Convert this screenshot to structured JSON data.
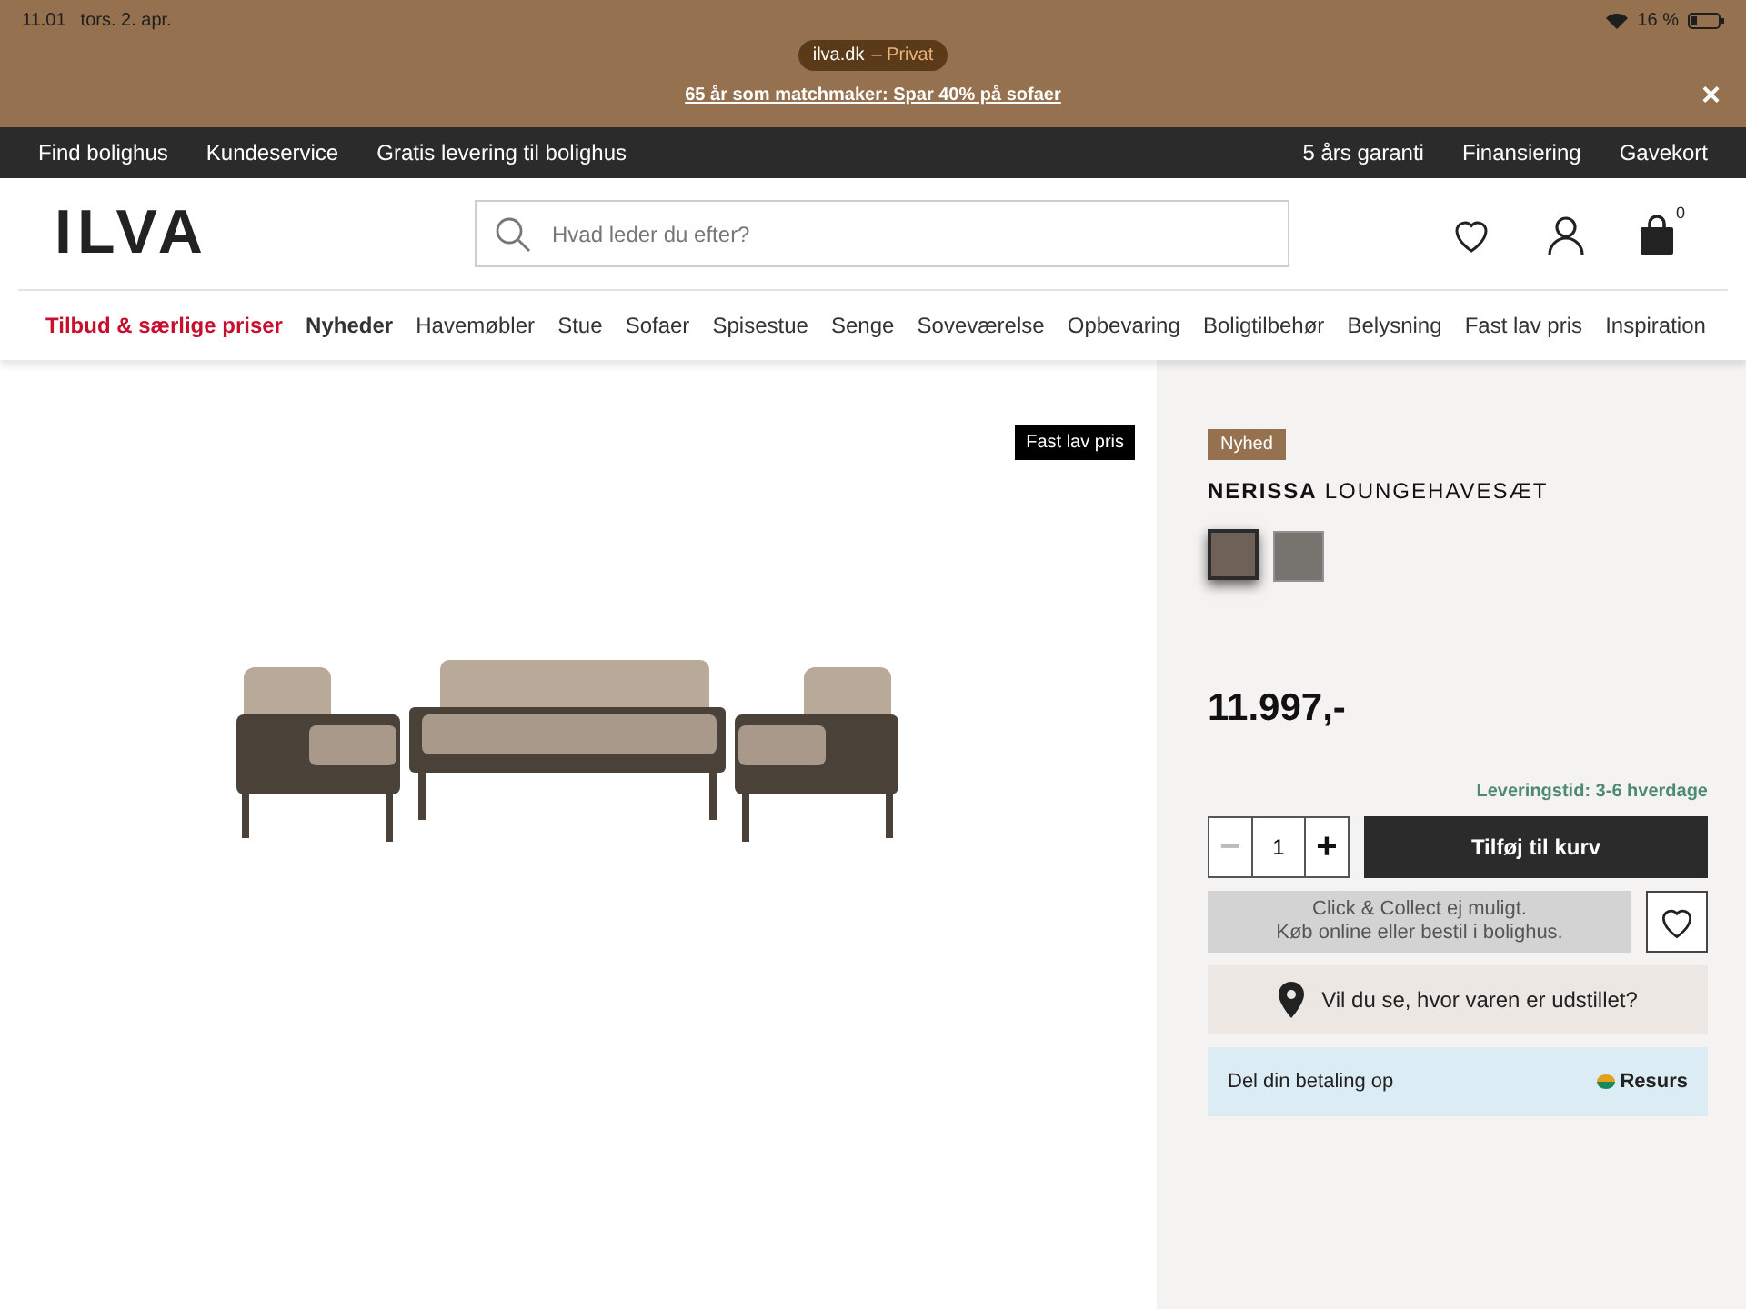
{
  "status_bar": {
    "time": "11.01",
    "date": "tors. 2. apr.",
    "battery": "16 %"
  },
  "browser": {
    "domain": "ilva.dk",
    "mode": "– Privat"
  },
  "promo": {
    "text": "65 år som matchmaker: Spar 40% på sofaer",
    "close": "×"
  },
  "top_links_left": [
    "Find bolighus",
    "Kundeservice",
    "Gratis levering til bolighus"
  ],
  "top_links_right": [
    "5 års garanti",
    "Finansiering",
    "Gavekort"
  ],
  "header": {
    "logo": "ILVA",
    "search_placeholder": "Hvad leder du efter?",
    "cart_count": "0"
  },
  "nav": [
    {
      "label": "Tilbud & særlige priser",
      "kind": "sale"
    },
    {
      "label": "Nyheder",
      "kind": "featured"
    },
    {
      "label": "Havemøbler",
      "kind": "normal"
    },
    {
      "label": "Stue",
      "kind": "normal"
    },
    {
      "label": "Sofaer",
      "kind": "normal"
    },
    {
      "label": "Spisestue",
      "kind": "normal"
    },
    {
      "label": "Senge",
      "kind": "normal"
    },
    {
      "label": "Soveværelse",
      "kind": "normal"
    },
    {
      "label": "Opbevaring",
      "kind": "normal"
    },
    {
      "label": "Boligtilbehør",
      "kind": "normal"
    },
    {
      "label": "Belysning",
      "kind": "normal"
    },
    {
      "label": "Fast lav pris",
      "kind": "normal"
    },
    {
      "label": "Inspiration",
      "kind": "normal"
    }
  ],
  "gallery": {
    "badge": "Fast lav pris"
  },
  "product": {
    "tag": "Nyhed",
    "brand": "NERISSA",
    "name": "LOUNGEHAVESÆT",
    "swatches": [
      {
        "color": "#6e6157",
        "selected": true
      },
      {
        "color": "#6c6a64",
        "selected": false
      }
    ],
    "price": "11.997,-",
    "delivery": "Leveringstid: 3-6 hverdage",
    "quantity": {
      "minus": "−",
      "value": "1",
      "plus": "+",
      "minus_disabled": true
    },
    "add_to_cart": "Tilføj til kurv",
    "click_collect": [
      "Click & Collect ej muligt.",
      "Køb online eller bestil i bolighus."
    ],
    "showroom": "Vil du se, hvor varen er udstillet?",
    "payment": {
      "text": "Del din betaling op",
      "provider": "Resurs"
    }
  }
}
